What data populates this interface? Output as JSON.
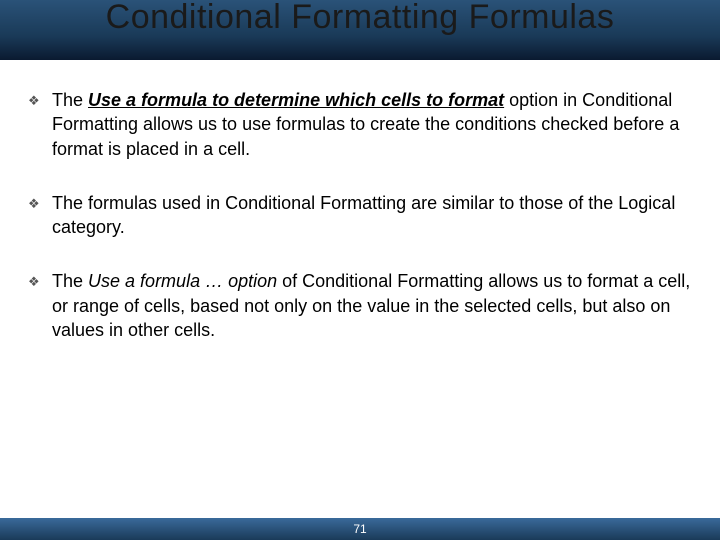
{
  "title": "Conditional Formatting Formulas",
  "bullets": [
    {
      "pre": "The ",
      "emph": "Use a formula to determine which cells to format",
      "emphClass": "uli",
      "post": " option in Conditional Formatting allows us to use formulas to create the conditions checked before a format is placed in a cell."
    },
    {
      "pre": "The formulas used in Conditional Formatting are similar to those of the Logical category.",
      "emph": "",
      "emphClass": "",
      "post": ""
    },
    {
      "pre": "The ",
      "emph": "Use a formula … option",
      "emphClass": "ital",
      "post": " of Conditional Formatting allows us to format a cell, or range of cells, based not only on the value in the selected cells, but also on values in other cells."
    }
  ],
  "pageNumber": "71",
  "bulletGlyph": "❖"
}
